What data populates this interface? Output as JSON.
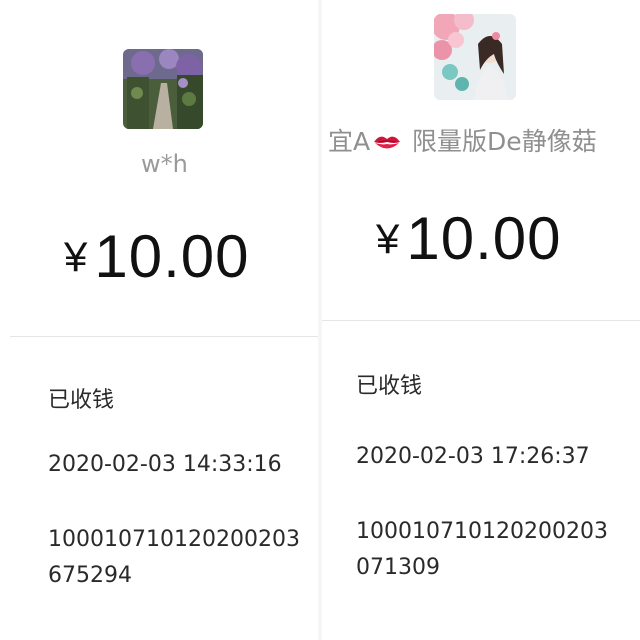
{
  "left_receipt": {
    "avatar_icon": "garden-path-photo",
    "payer_name": "w*h",
    "currency_symbol": "¥",
    "amount": "10.00",
    "status": "已收钱",
    "time": "2020-02-03 14:33:16",
    "transaction_id_line1": "100010710120200203",
    "transaction_id_line2": "675294"
  },
  "right_receipt": {
    "avatar_icon": "woman-with-flowers-photo",
    "payer_name_prefix": "宜A",
    "payer_name_emoji": "kiss-mark-icon",
    "payer_name_suffix": " 限量版De静像菇",
    "currency_symbol": "¥",
    "amount": "10.00",
    "status": "已收钱",
    "time": "2020-02-03 17:26:37",
    "transaction_id_line1": "100010710120200203",
    "transaction_id_line2": "071309"
  },
  "colors": {
    "amount": "#111111",
    "name": "#9a9a9a",
    "body_text": "#2a2a2a",
    "divider": "#e6e6e6",
    "kiss_mark": "#d0153a"
  }
}
